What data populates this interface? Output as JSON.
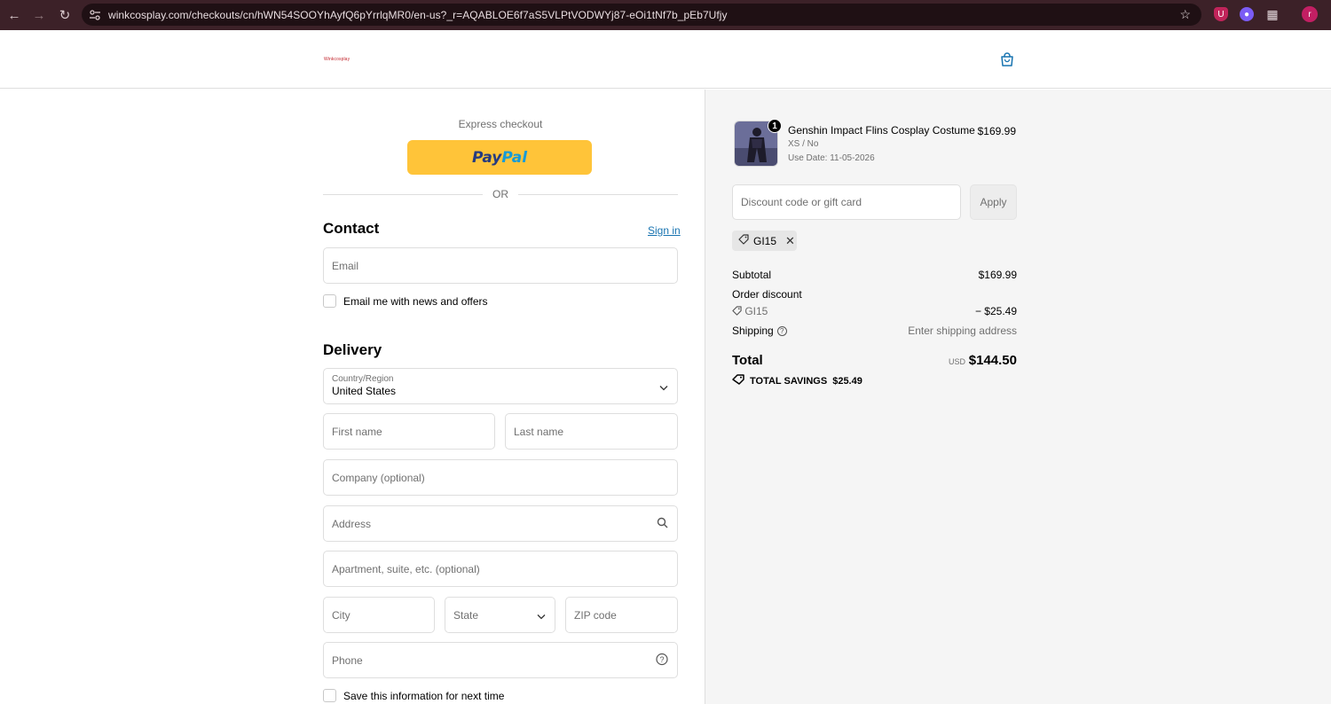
{
  "browser": {
    "url": "winkcosplay.com/checkouts/cn/hWN54SOOYhAyfQ6pYrrlqMR0/en-us?_r=AQABLOE6f7aS5VLPtVODWYj87-eOi1tNf7b_pEb7Ufjy",
    "avatar_letter": "r",
    "ext1_letter": "U"
  },
  "header": {
    "logo_text": "Winkcosplay"
  },
  "checkout": {
    "express_label": "Express checkout",
    "paypal_pay": "Pay",
    "paypal_pal": "Pal",
    "or_label": "OR",
    "contact_title": "Contact",
    "sign_in": "Sign in",
    "email_placeholder": "Email",
    "news_label": "Email me with news and offers",
    "delivery_title": "Delivery",
    "country_label": "Country/Region",
    "country_value": "United States",
    "first_name": "First name",
    "last_name": "Last name",
    "company": "Company (optional)",
    "address": "Address",
    "apartment": "Apartment, suite, etc. (optional)",
    "city": "City",
    "state": "State",
    "zip": "ZIP code",
    "phone": "Phone",
    "save_info": "Save this information for next time"
  },
  "summary": {
    "product": {
      "qty": "1",
      "name": "Genshin Impact Flins Cosplay Costume",
      "variant": "XS / No",
      "use_date": "Use Date: 11-05-2026",
      "price": "$169.99"
    },
    "discount_placeholder": "Discount code or gift card",
    "apply_label": "Apply",
    "code": "GI15",
    "subtotal_label": "Subtotal",
    "subtotal_value": "$169.99",
    "order_discount_label": "Order discount",
    "discount_code": "GI15",
    "discount_value": "− $25.49",
    "shipping_label": "Shipping",
    "shipping_value": "Enter shipping address",
    "total_label": "Total",
    "currency": "USD",
    "total_value": "$144.50",
    "savings_label": "TOTAL SAVINGS",
    "savings_value": "$25.49"
  }
}
